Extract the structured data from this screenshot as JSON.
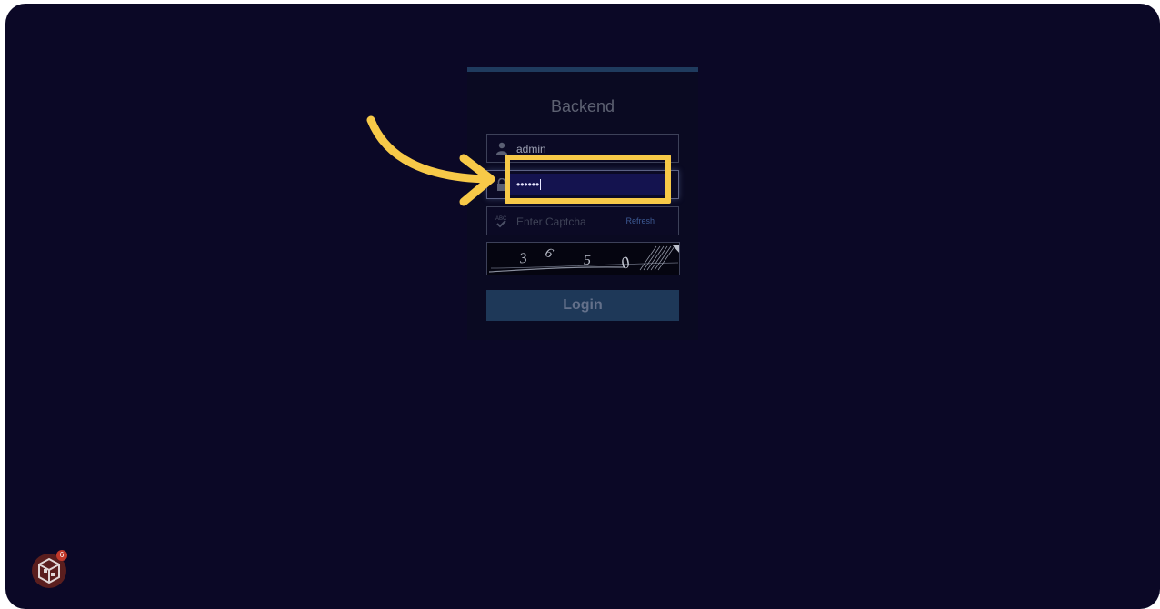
{
  "login": {
    "title": "Backend",
    "username_value": "admin",
    "password_value": "••••••",
    "captcha_placeholder": "Enter Captcha",
    "captcha_icon_text": "ABC",
    "refresh_label": "Refresh",
    "login_button": "Login"
  },
  "badge": {
    "count": "6"
  },
  "colors": {
    "background": "#0b0826",
    "highlight": "#f7c948",
    "button": "#1e3858",
    "card_accent": "#1f3b5e"
  },
  "icons": {
    "username": "user-icon",
    "password": "lock-icon",
    "captcha": "captcha-check-icon",
    "annotation": "curved-arrow-icon",
    "app": "app-logo-icon"
  }
}
